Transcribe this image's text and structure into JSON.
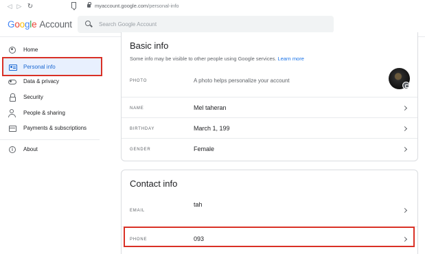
{
  "browser": {
    "url_domain": "myaccount.google.com",
    "url_path": "/personal-info"
  },
  "header": {
    "logo_letters": [
      "G",
      "o",
      "o",
      "g",
      "l",
      "e"
    ],
    "logo_suffix": "Account",
    "search_placeholder": "Search Google Account"
  },
  "sidebar": {
    "items": [
      {
        "label": "Home",
        "icon": "home-icon"
      },
      {
        "label": "Personal info",
        "icon": "personal-info-icon",
        "active": true
      },
      {
        "label": "Data & privacy",
        "icon": "toggle-icon"
      },
      {
        "label": "Security",
        "icon": "lock-icon"
      },
      {
        "label": "People & sharing",
        "icon": "people-icon"
      },
      {
        "label": "Payments & subscriptions",
        "icon": "card-icon"
      },
      {
        "label": "About",
        "icon": "info-icon"
      }
    ]
  },
  "basic_info": {
    "title": "Basic info",
    "subtitle": "Some info may be visible to other people using Google services.",
    "learn_more": "Learn more",
    "photo_label": "PHOTO",
    "photo_text": "A photo helps personalize your account",
    "rows": [
      {
        "label": "NAME",
        "value": "Mel taheran"
      },
      {
        "label": "BIRTHDAY",
        "value": "March 1, 199"
      },
      {
        "label": "GENDER",
        "value": "Female"
      }
    ]
  },
  "contact_info": {
    "title": "Contact info",
    "email_label": "EMAIL",
    "email_value": "tah",
    "phone_label": "PHONE",
    "phone_value": "093"
  },
  "colors": {
    "accent": "#1a73e8",
    "active_bg": "#e8f0fe",
    "highlight_red": "#d93025"
  }
}
